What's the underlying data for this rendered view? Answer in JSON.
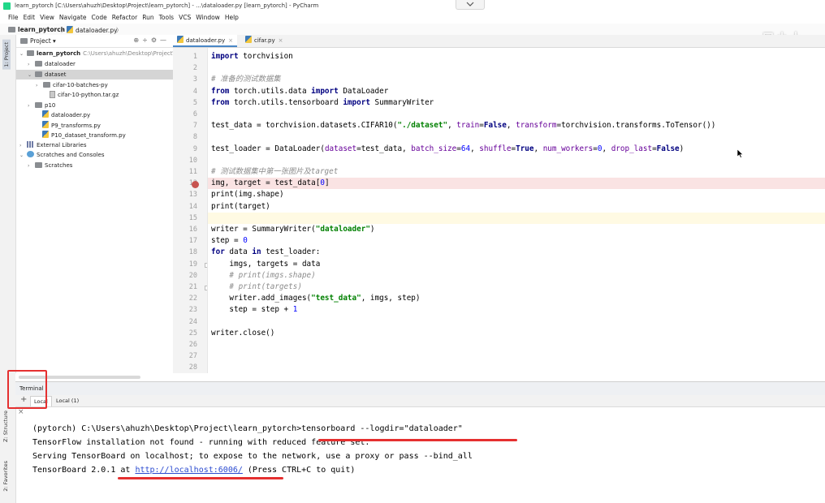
{
  "window": {
    "title": "learn_pytorch [C:\\Users\\ahuzh\\Desktop\\Project\\learn_pytorch] - ...\\dataloader.py [learn_pytorch] - PyCharm"
  },
  "menu": [
    "File",
    "Edit",
    "View",
    "Navigate",
    "Code",
    "Refactor",
    "Run",
    "Tools",
    "VCS",
    "Window",
    "Help"
  ],
  "navbar": {
    "project": "learn_pytorch",
    "file": "dataloader.py"
  },
  "watermark": "一只小土",
  "left_strip": {
    "project_tab": "1: Project",
    "structure_tab": "Z: Structure",
    "favorites_tab": "2: Favorites"
  },
  "project_panel": {
    "title": "Project",
    "tree": [
      {
        "label": "learn_pytorch",
        "path": "C:\\Users\\ahuzh\\Desktop\\Project\\l",
        "icon": "folder",
        "arrow": "down"
      },
      {
        "label": "dataloader",
        "icon": "folder",
        "arrow": "right"
      },
      {
        "label": "dataset",
        "icon": "folder",
        "arrow": "down"
      },
      {
        "label": "cifar-10-batches-py",
        "icon": "folder",
        "arrow": "right"
      },
      {
        "label": "cifar-10-python.tar.gz",
        "icon": "archive",
        "arrow": ""
      },
      {
        "label": "p10",
        "icon": "folder",
        "arrow": "right"
      },
      {
        "label": "dataloader.py",
        "icon": "python-file",
        "arrow": ""
      },
      {
        "label": "P9_transforms.py",
        "icon": "python-file",
        "arrow": ""
      },
      {
        "label": "P10_dataset_transform.py",
        "icon": "python-file",
        "arrow": ""
      },
      {
        "label": "External Libraries",
        "icon": "library",
        "arrow": "right"
      },
      {
        "label": "Scratches and Consoles",
        "icon": "scratch",
        "arrow": "down"
      },
      {
        "label": "Scratches",
        "icon": "folder",
        "arrow": "right"
      }
    ]
  },
  "editor_tabs": [
    {
      "label": "dataloader.py",
      "active": true
    },
    {
      "label": "cifar.py",
      "active": false
    }
  ],
  "editor": {
    "breakpoint_line": 12,
    "current_line": 15,
    "lines": [
      "import torchvision",
      "",
      "# 准备的测试数据集",
      "from torch.utils.data import DataLoader",
      "from torch.utils.tensorboard import SummaryWriter",
      "",
      "test_data = torchvision.datasets.CIFAR10(\"./dataset\", train=False, transform=torchvision.transforms.ToTensor())",
      "",
      "test_loader = DataLoader(dataset=test_data, batch_size=64, shuffle=True, num_workers=0, drop_last=False)",
      "",
      "# 测试数据集中第一张图片及target",
      "img, target = test_data[0]",
      "print(img.shape)",
      "print(target)",
      "",
      "writer = SummaryWriter(\"dataloader\")",
      "step = 0",
      "for data in test_loader:",
      "    imgs, targets = data",
      "    # print(imgs.shape)",
      "    # print(targets)",
      "    writer.add_images(\"test_data\", imgs, step)",
      "    step = step + 1",
      "",
      "writer.close()",
      "",
      "",
      ""
    ],
    "line_numbers": [
      "1",
      "2",
      "3",
      "4",
      "5",
      "6",
      "7",
      "8",
      "9",
      "10",
      "11",
      "12",
      "13",
      "14",
      "15",
      "16",
      "17",
      "18",
      "19",
      "20",
      "21",
      "22",
      "23",
      "24",
      "25",
      "26",
      "27",
      "28"
    ]
  },
  "terminal": {
    "title": "Terminal",
    "tabs": [
      {
        "label": "Local",
        "active": true
      },
      {
        "label": "Local (1)",
        "active": false
      }
    ],
    "plus": "+",
    "close": "×",
    "prompt": "(pytorch) C:\\Users\\ahuzh\\Desktop\\Project\\learn_pytorch>",
    "command": "tensorboard --logdir=\"dataloader\"",
    "output_1": "TensorFlow installation not found - running with reduced feature set.",
    "output_2": "Serving TensorBoard on localhost; to expose to the network, use a proxy or pass --bind_all",
    "output_3_pre": "TensorBoard 2.0.1 at ",
    "output_3_link": "http://localhost:6006/",
    "output_3_post": " (Press CTRL+C to quit)"
  },
  "colors": {
    "keyword": "#000080",
    "string": "#008000",
    "number": "#0000ff",
    "comment": "#8c8c8c",
    "breakpoint": "#c75450",
    "annotation_red": "#e53030",
    "link": "#2a4ad0"
  }
}
